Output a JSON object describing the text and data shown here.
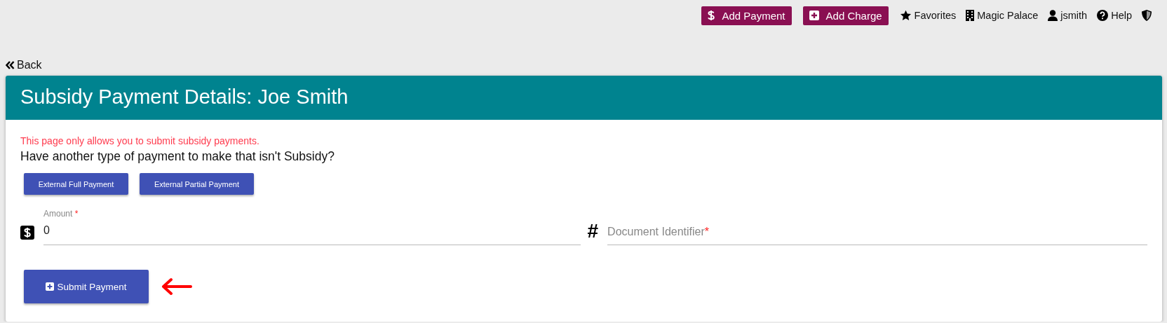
{
  "topbar": {
    "buttons": [
      {
        "label": "Add Payment"
      },
      {
        "label": "Add Charge"
      }
    ],
    "links": [
      {
        "label": "Favorites"
      },
      {
        "label": "Magic Palace"
      },
      {
        "label": "jsmith"
      },
      {
        "label": "Help"
      }
    ]
  },
  "back": {
    "label": "Back"
  },
  "card": {
    "title": "Subsidy Payment Details: Joe Smith",
    "warning": "This page only allows you to submit subsidy payments.",
    "question": "Have another type of payment to make that isn't Subsidy?",
    "alt_buttons": [
      "External Full Payment",
      "External Partial Payment"
    ],
    "fields": [
      {
        "label": "Amount",
        "required_mark": "*",
        "value": "0"
      },
      {
        "icon_text": "#",
        "label": "Document Identifier",
        "required_mark": "*"
      }
    ],
    "submit": {
      "label": "Submit Payment"
    }
  }
}
